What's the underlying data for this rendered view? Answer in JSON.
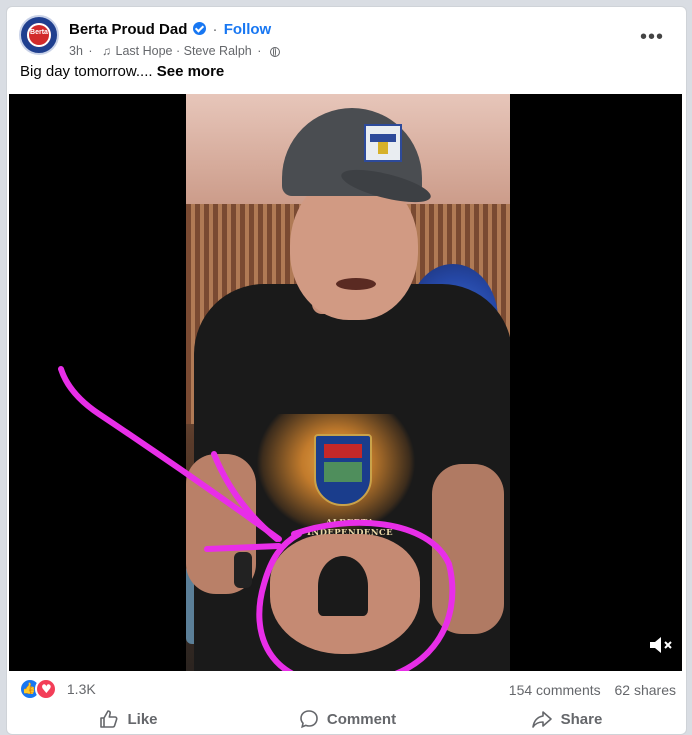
{
  "post": {
    "author": "Berta Proud Dad",
    "follow_label": "Follow",
    "time": "3h",
    "audio_track": "Last Hope · Steve Ralph",
    "caption": "Big day tomorrow....",
    "see_more_label": "See more",
    "avatar_text": "Berta"
  },
  "video": {
    "shirt_text": "ALBERTA INDEPENDENCE",
    "muted": true
  },
  "stats": {
    "reactions_count": "1.3K",
    "comments": "154 comments",
    "shares": "62 shares"
  },
  "actions": {
    "like": "Like",
    "comment": "Comment",
    "share": "Share"
  },
  "colors": {
    "accent": "#1877f2",
    "annotation": "#e82ee8"
  },
  "icons": [
    "verified-badge-icon",
    "music-note-icon",
    "globe-icon",
    "more-options-icon",
    "mute-icon",
    "like-reaction-icon",
    "love-reaction-icon",
    "like-icon",
    "comment-icon",
    "share-icon"
  ]
}
